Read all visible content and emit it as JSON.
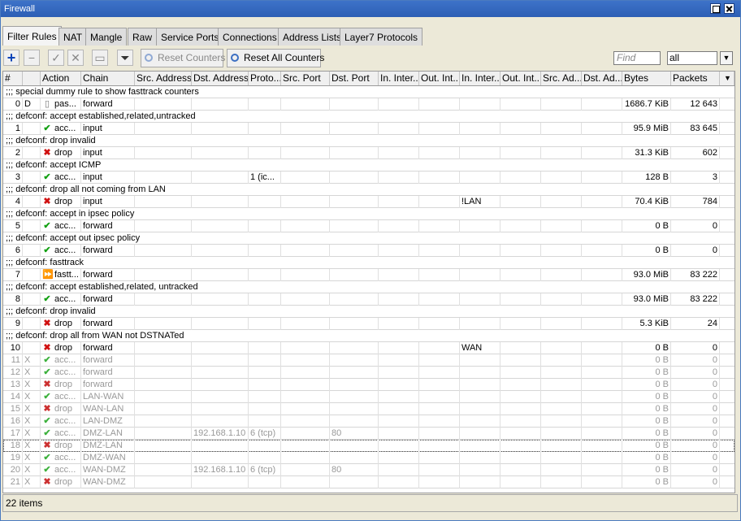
{
  "window": {
    "title": "Firewall"
  },
  "tabs": [
    "Filter Rules",
    "NAT",
    "Mangle",
    "Raw",
    "Service Ports",
    "Connections",
    "Address Lists",
    "Layer7 Protocols"
  ],
  "toolbar": {
    "add_icon": "plus-icon",
    "remove_icon": "minus-icon",
    "enable_icon": "check-icon",
    "disable_icon": "x-icon",
    "comment_icon": "note-icon",
    "filter_icon": "funnel-icon",
    "reset_counters": "Reset Counters",
    "reset_all_counters": "Reset All Counters",
    "find_placeholder": "Find",
    "filter_value": "all"
  },
  "columns": [
    "#",
    "",
    "Action",
    "Chain",
    "Src. Address",
    "Dst. Address",
    "Proto...",
    "Src. Port",
    "Dst. Port",
    "In. Inter...",
    "Out. Int...",
    "In. Inter...",
    "Out. Int...",
    "Src. Ad...",
    "Dst. Ad...",
    "Bytes",
    "Packets"
  ],
  "rows": [
    {
      "type": "comment",
      "text": ";;; special dummy rule to show fasttrack counters"
    },
    {
      "type": "rule",
      "num": "0",
      "flag": "D",
      "icon": "passthrough",
      "action": "pas...",
      "chain": "forward",
      "proto": "",
      "dst_addr": "",
      "dst_port": "",
      "in_list": "",
      "bytes": "1686.7 KiB",
      "packets": "12 643"
    },
    {
      "type": "comment",
      "text": ";;; defconf: accept established,related,untracked"
    },
    {
      "type": "rule",
      "num": "1",
      "flag": "",
      "icon": "accept",
      "action": "acc...",
      "chain": "input",
      "proto": "",
      "dst_addr": "",
      "dst_port": "",
      "in_list": "",
      "bytes": "95.9 MiB",
      "packets": "83 645"
    },
    {
      "type": "comment",
      "text": ";;; defconf: drop invalid"
    },
    {
      "type": "rule",
      "num": "2",
      "flag": "",
      "icon": "drop",
      "action": "drop",
      "chain": "input",
      "proto": "",
      "dst_addr": "",
      "dst_port": "",
      "in_list": "",
      "bytes": "31.3 KiB",
      "packets": "602"
    },
    {
      "type": "comment",
      "text": ";;; defconf: accept ICMP"
    },
    {
      "type": "rule",
      "num": "3",
      "flag": "",
      "icon": "accept",
      "action": "acc...",
      "chain": "input",
      "proto": "1 (ic...",
      "dst_addr": "",
      "dst_port": "",
      "in_list": "",
      "bytes": "128 B",
      "packets": "3"
    },
    {
      "type": "comment",
      "text": ";;; defconf: drop all not coming from LAN"
    },
    {
      "type": "rule",
      "num": "4",
      "flag": "",
      "icon": "drop",
      "action": "drop",
      "chain": "input",
      "proto": "",
      "dst_addr": "",
      "dst_port": "",
      "in_list": "!LAN",
      "bytes": "70.4 KiB",
      "packets": "784"
    },
    {
      "type": "comment",
      "text": ";;; defconf: accept in ipsec policy"
    },
    {
      "type": "rule",
      "num": "5",
      "flag": "",
      "icon": "accept",
      "action": "acc...",
      "chain": "forward",
      "proto": "",
      "dst_addr": "",
      "dst_port": "",
      "in_list": "",
      "bytes": "0 B",
      "packets": "0"
    },
    {
      "type": "comment",
      "text": ";;; defconf: accept out ipsec policy"
    },
    {
      "type": "rule",
      "num": "6",
      "flag": "",
      "icon": "accept",
      "action": "acc...",
      "chain": "forward",
      "proto": "",
      "dst_addr": "",
      "dst_port": "",
      "in_list": "",
      "bytes": "0 B",
      "packets": "0"
    },
    {
      "type": "comment",
      "text": ";;; defconf: fasttrack"
    },
    {
      "type": "rule",
      "num": "7",
      "flag": "",
      "icon": "fasttrack",
      "action": "fastt...",
      "chain": "forward",
      "proto": "",
      "dst_addr": "",
      "dst_port": "",
      "in_list": "",
      "bytes": "93.0 MiB",
      "packets": "83 222"
    },
    {
      "type": "comment",
      "text": ";;; defconf: accept established,related, untracked"
    },
    {
      "type": "rule",
      "num": "8",
      "flag": "",
      "icon": "accept",
      "action": "acc...",
      "chain": "forward",
      "proto": "",
      "dst_addr": "",
      "dst_port": "",
      "in_list": "",
      "bytes": "93.0 MiB",
      "packets": "83 222"
    },
    {
      "type": "comment",
      "text": ";;; defconf: drop invalid"
    },
    {
      "type": "rule",
      "num": "9",
      "flag": "",
      "icon": "drop",
      "action": "drop",
      "chain": "forward",
      "proto": "",
      "dst_addr": "",
      "dst_port": "",
      "in_list": "",
      "bytes": "5.3 KiB",
      "packets": "24"
    },
    {
      "type": "comment",
      "text": ";;; defconf:  drop all from WAN not DSTNATed"
    },
    {
      "type": "rule",
      "num": "10",
      "flag": "",
      "icon": "drop",
      "action": "drop",
      "chain": "forward",
      "proto": "",
      "dst_addr": "",
      "dst_port": "",
      "in_list": "WAN",
      "bytes": "0 B",
      "packets": "0"
    },
    {
      "type": "rule",
      "num": "11",
      "flag": "X",
      "icon": "accept",
      "action": "acc...",
      "chain": "forward",
      "proto": "",
      "dst_addr": "",
      "dst_port": "",
      "in_list": "",
      "bytes": "0 B",
      "packets": "0",
      "disabled": true
    },
    {
      "type": "rule",
      "num": "12",
      "flag": "X",
      "icon": "accept",
      "action": "acc...",
      "chain": "forward",
      "proto": "",
      "dst_addr": "",
      "dst_port": "",
      "in_list": "",
      "bytes": "0 B",
      "packets": "0",
      "disabled": true
    },
    {
      "type": "rule",
      "num": "13",
      "flag": "X",
      "icon": "drop",
      "action": "drop",
      "chain": "forward",
      "proto": "",
      "dst_addr": "",
      "dst_port": "",
      "in_list": "",
      "bytes": "0 B",
      "packets": "0",
      "disabled": true
    },
    {
      "type": "rule",
      "num": "14",
      "flag": "X",
      "icon": "accept",
      "action": "acc...",
      "chain": "LAN-WAN",
      "proto": "",
      "dst_addr": "",
      "dst_port": "",
      "in_list": "",
      "bytes": "0 B",
      "packets": "0",
      "disabled": true
    },
    {
      "type": "rule",
      "num": "15",
      "flag": "X",
      "icon": "drop",
      "action": "drop",
      "chain": "WAN-LAN",
      "proto": "",
      "dst_addr": "",
      "dst_port": "",
      "in_list": "",
      "bytes": "0 B",
      "packets": "0",
      "disabled": true
    },
    {
      "type": "rule",
      "num": "16",
      "flag": "X",
      "icon": "accept",
      "action": "acc...",
      "chain": "LAN-DMZ",
      "proto": "",
      "dst_addr": "",
      "dst_port": "",
      "in_list": "",
      "bytes": "0 B",
      "packets": "0",
      "disabled": true
    },
    {
      "type": "rule",
      "num": "17",
      "flag": "X",
      "icon": "accept",
      "action": "acc...",
      "chain": "DMZ-LAN",
      "proto": "6 (tcp)",
      "dst_addr": "192.168.1.10",
      "dst_port": "80",
      "in_list": "",
      "bytes": "0 B",
      "packets": "0",
      "disabled": true
    },
    {
      "type": "rule",
      "num": "18",
      "flag": "X",
      "icon": "drop",
      "action": "drop",
      "chain": "DMZ-LAN",
      "proto": "",
      "dst_addr": "",
      "dst_port": "",
      "in_list": "",
      "bytes": "0 B",
      "packets": "0",
      "disabled": true,
      "selected": true
    },
    {
      "type": "rule",
      "num": "19",
      "flag": "X",
      "icon": "accept",
      "action": "acc...",
      "chain": "DMZ-WAN",
      "proto": "",
      "dst_addr": "",
      "dst_port": "",
      "in_list": "",
      "bytes": "0 B",
      "packets": "0",
      "disabled": true
    },
    {
      "type": "rule",
      "num": "20",
      "flag": "X",
      "icon": "accept",
      "action": "acc...",
      "chain": "WAN-DMZ",
      "proto": "6 (tcp)",
      "dst_addr": "192.168.1.10",
      "dst_port": "80",
      "in_list": "",
      "bytes": "0 B",
      "packets": "0",
      "disabled": true
    },
    {
      "type": "rule",
      "num": "21",
      "flag": "X",
      "icon": "drop",
      "action": "drop",
      "chain": "WAN-DMZ",
      "proto": "",
      "dst_addr": "",
      "dst_port": "",
      "in_list": "",
      "bytes": "0 B",
      "packets": "0",
      "disabled": true
    }
  ],
  "status": {
    "count": "22 items"
  },
  "colors": {
    "accent": "#2d5fb5",
    "accept": "#12a012",
    "drop": "#d01010"
  }
}
